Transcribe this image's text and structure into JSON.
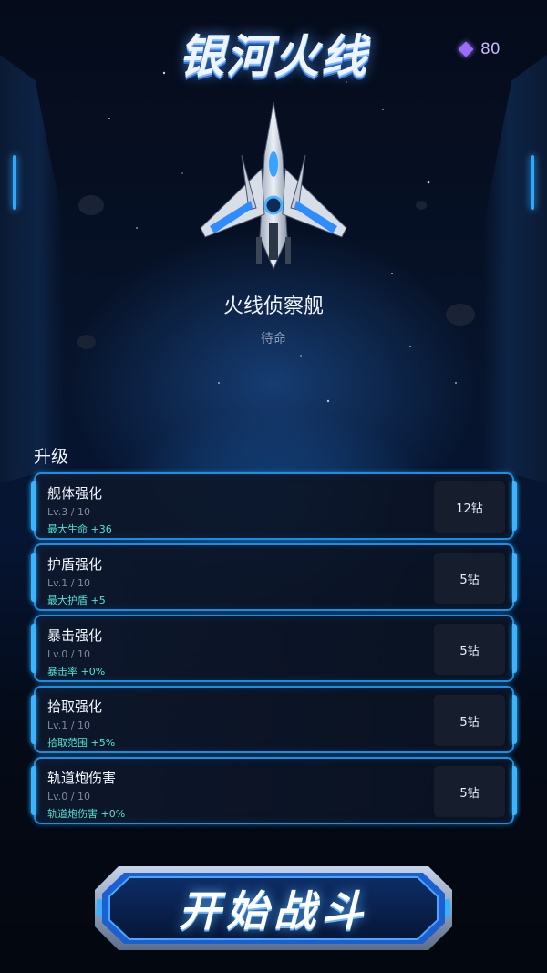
{
  "game": {
    "title": "银河火线"
  },
  "currency": {
    "icon": "gem-icon",
    "value": "80"
  },
  "ship": {
    "name": "火线侦察舰",
    "status": "待命"
  },
  "upgrades": {
    "section_title": "升级",
    "items": [
      {
        "name": "舰体强化",
        "level": "Lv.3 / 10",
        "bonus": "最大生命 +36",
        "cost": "12钻"
      },
      {
        "name": "护盾强化",
        "level": "Lv.1 / 10",
        "bonus": "最大护盾 +5",
        "cost": "5钻"
      },
      {
        "name": "暴击强化",
        "level": "Lv.0 / 10",
        "bonus": "暴击率 +0%",
        "cost": "5钻"
      },
      {
        "name": "拾取强化",
        "level": "Lv.1 / 10",
        "bonus": "拾取范围 +5%",
        "cost": "5钻"
      },
      {
        "name": "轨道炮伤害",
        "level": "Lv.0 / 10",
        "bonus": "轨道炮伤害 +0%",
        "cost": "5钻"
      }
    ]
  },
  "start": {
    "label": "开始战斗"
  },
  "colors": {
    "accent": "#1d8fe0",
    "bonus": "#4fe3d6",
    "gem": "#9b6dff"
  }
}
